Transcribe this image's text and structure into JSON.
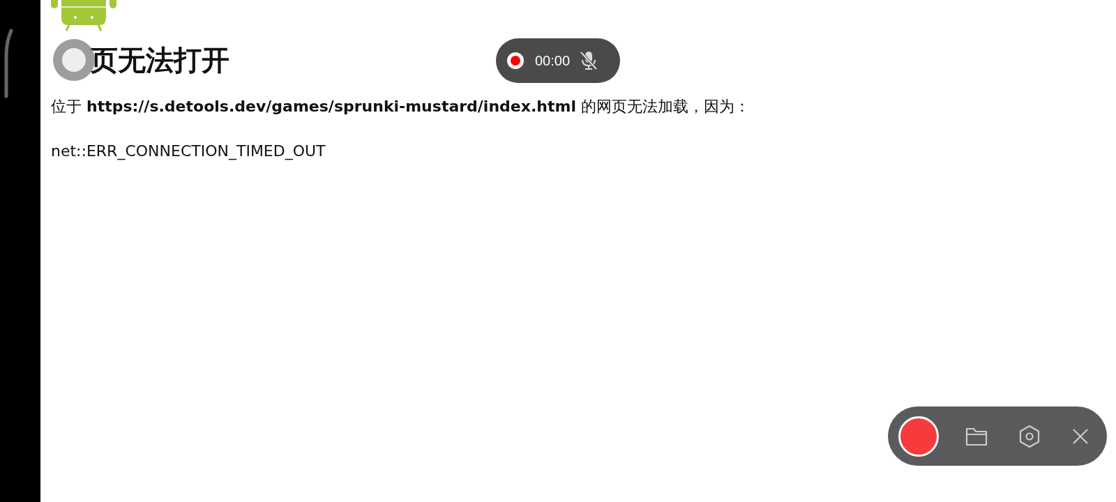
{
  "error_page": {
    "heading": "页无法打开",
    "message": "位于 **https://s.detools.dev/games/sprunki-mustard/index.html** 的网页无法加载，因为：",
    "error_code": "net::ERR_CONNECTION_TIMED_OUT"
  },
  "recorder_pill": {
    "time": "00:00",
    "mic_muted": true
  }
}
